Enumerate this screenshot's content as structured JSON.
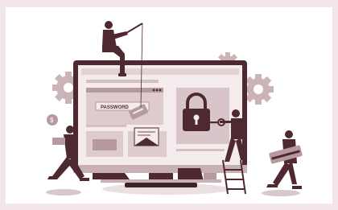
{
  "illustration": {
    "subject": "cyber-attack-on-website",
    "password_tag_text": "PASSWORD",
    "colors": {
      "outer_background": "#f2e6e8",
      "card_background": "#ffffff",
      "dark": "#4e2a30",
      "mid": "#b79aa0",
      "light": "#e5d5d8",
      "pale": "#f3ebec"
    }
  }
}
